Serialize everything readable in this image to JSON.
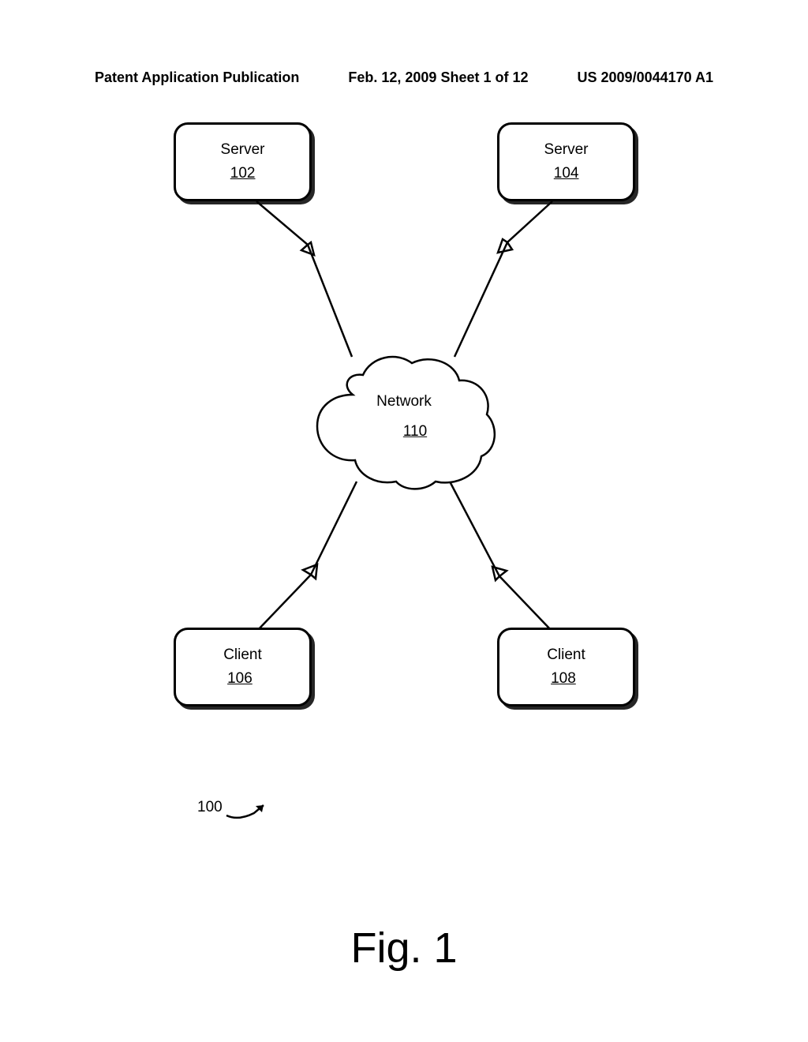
{
  "header": {
    "left": "Patent Application Publication",
    "center": "Feb. 12, 2009  Sheet 1 of 12",
    "right": "US 2009/0044170 A1"
  },
  "nodes": {
    "server1": {
      "label": "Server",
      "ref": "102"
    },
    "server2": {
      "label": "Server",
      "ref": "104"
    },
    "client1": {
      "label": "Client",
      "ref": "106"
    },
    "client2": {
      "label": "Client",
      "ref": "108"
    },
    "network": {
      "label": "Network",
      "ref": "110"
    }
  },
  "figure_ref": "100",
  "figure_label": "Fig. 1"
}
